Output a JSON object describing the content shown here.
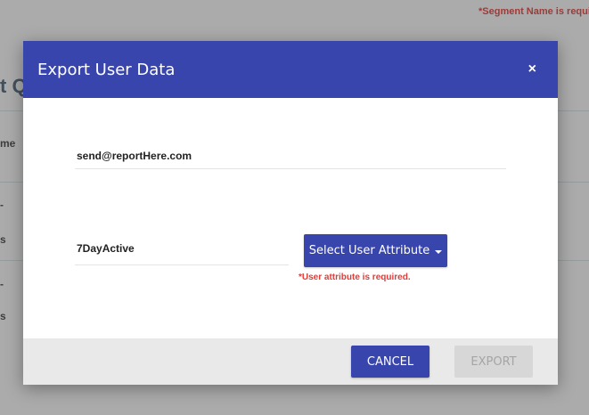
{
  "background": {
    "segment_error": "*Segment Name is required.",
    "title_fragment": "t Q",
    "label_fragment": "me",
    "row_fragments": [
      "-",
      "s",
      "-",
      "s"
    ]
  },
  "modal": {
    "title": "Export User Data",
    "close_icon": "×",
    "email_value": "send@reportHere.com",
    "segment_value": "7DayActive",
    "attribute_button_label": "Select User Attribute",
    "attribute_error": "*User attribute is required.",
    "cancel_label": "CANCEL",
    "export_label": "EXPORT"
  },
  "colors": {
    "primary": "#3845ad",
    "error": "#e53935",
    "disabled_bg": "#d7d7d7",
    "disabled_text": "#a5a5a5"
  }
}
